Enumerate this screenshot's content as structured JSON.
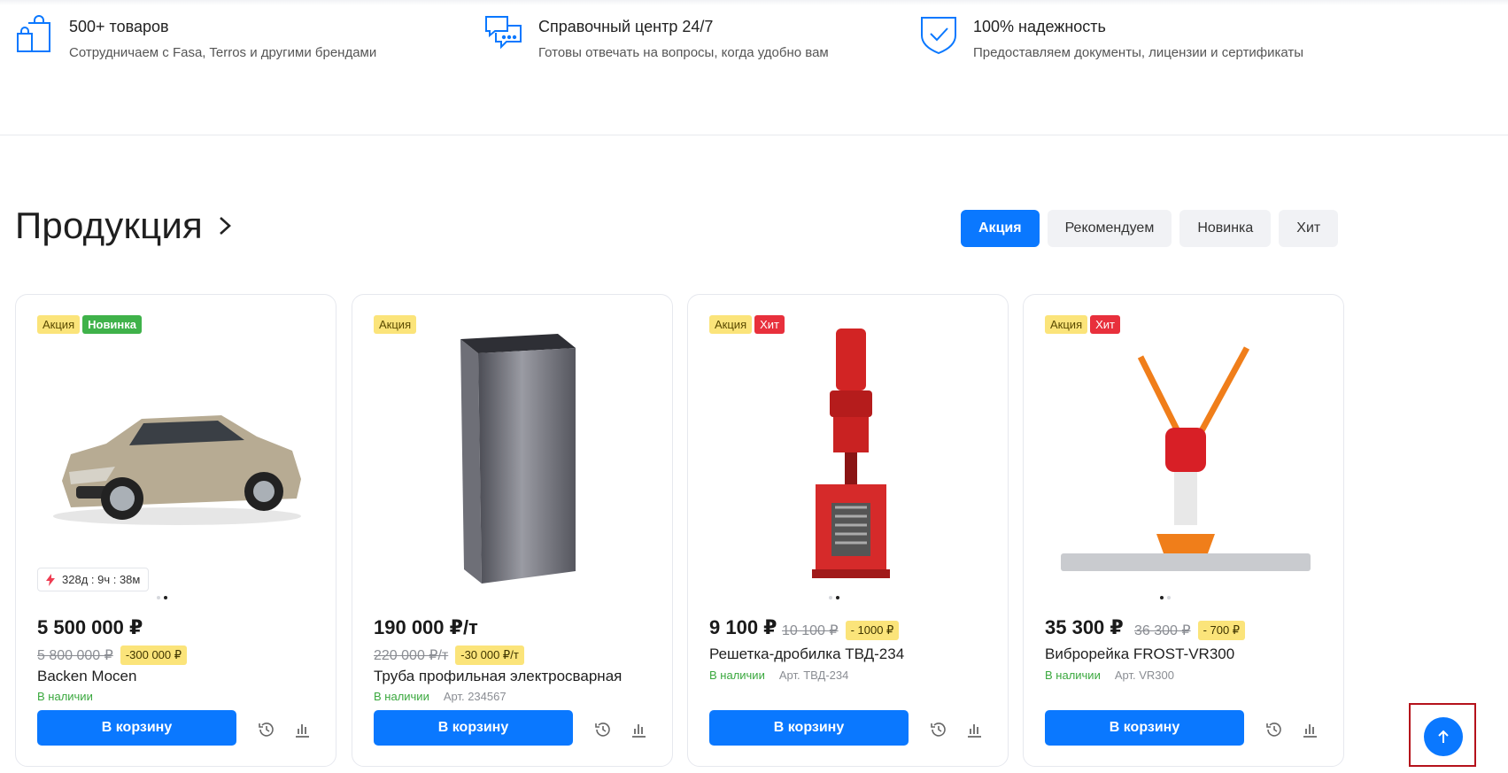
{
  "features": [
    {
      "icon": "shopping-bags-icon",
      "title": "500+ товаров",
      "desc": "Сотрудничаем с Fasa, Terros и другими брендами"
    },
    {
      "icon": "chat-bubbles-icon",
      "title": "Справочный центр 24/7",
      "desc": "Готовы отвечать на вопросы, когда удобно вам"
    },
    {
      "icon": "shield-check-icon",
      "title": "100% надежность",
      "desc": "Предоставляем документы, лицензии и сертификаты"
    }
  ],
  "section": {
    "title": "Продукция"
  },
  "filters": [
    "Акция",
    "Рекомендуем",
    "Новинка",
    "Хит"
  ],
  "colors": {
    "accent": "#0a78ff",
    "sale_badge": "#fbe47a",
    "new_badge": "#3fb24a",
    "hit_badge": "#e8303c",
    "in_stock": "#3aa83e"
  },
  "products": [
    {
      "badges": [
        "Акция",
        "Новинка"
      ],
      "timer": "328д : 9ч : 38м",
      "price": "5 500 000 ₽",
      "old_price": "5 800 000 ₽",
      "discount": "-300 000 ₽",
      "name": "Backen Mocen",
      "stock": "В наличии",
      "art": "",
      "cart": "В корзину"
    },
    {
      "badges": [
        "Акция"
      ],
      "price": "190 000 ₽/т",
      "old_price": "220 000 ₽/т",
      "discount": "-30 000 ₽/т",
      "name": "Труба профильная электросварная",
      "stock": "В наличии",
      "art": "Арт. 234567",
      "cart": "В корзину"
    },
    {
      "badges": [
        "Акция",
        "Хит"
      ],
      "price": "9 100 ₽",
      "old_price": "10 100 ₽",
      "discount": "- 1000 ₽",
      "name": "Решетка-дробилка ТВД-234",
      "stock": "В наличии",
      "art": "Арт. ТВД-234",
      "cart": "В корзину"
    },
    {
      "badges": [
        "Акция",
        "Хит"
      ],
      "price": "35 300 ₽",
      "old_price": "36 300 ₽",
      "discount": "- 700 ₽",
      "name": "Виброрейка FROST-VR300",
      "stock": "В наличии",
      "art": "Арт. VR300",
      "cart": "В корзину"
    }
  ]
}
